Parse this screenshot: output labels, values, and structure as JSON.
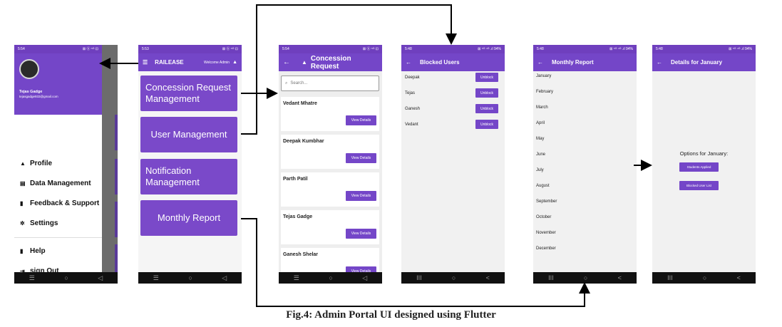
{
  "caption": "Fig.4: Admin Portal UI designed using Flutter",
  "phone1": {
    "status_time": "5:54",
    "status_icons": "⊠ ⓑ ⁵ᴳ ⊡",
    "name": "Tejas Gadge",
    "email": "tejasgadge933@gmail.com",
    "items": [
      {
        "icon": "person-icon",
        "glyph": "▲",
        "label": "Profile"
      },
      {
        "icon": "data-icon",
        "glyph": "▤",
        "label": "Data Management"
      },
      {
        "icon": "feedback-icon",
        "glyph": "▮",
        "label": "Feedback & Support"
      },
      {
        "icon": "gear-icon",
        "glyph": "✲",
        "label": "Settings"
      },
      {
        "icon": "help-icon",
        "glyph": "▮",
        "label": "Help"
      },
      {
        "icon": "logout-icon",
        "glyph": "⇥",
        "label": "sign Out"
      }
    ]
  },
  "phone2": {
    "status_time": "5:53",
    "status_icons": "⊠ ⓑ ⁵ᴳ ⊡",
    "title": "RAILEASE",
    "welcome": "Welcome Admin",
    "cards": [
      "Concession Request Management",
      "User Management",
      "Notification Management",
      "Monthly Report"
    ]
  },
  "phone3": {
    "status_time": "5:54",
    "status_icons": "⊠ ⓑ ⁵ᴳ ⊡",
    "title": "Concession Request",
    "search_placeholder": "Search...",
    "view_label": "View Details",
    "requests": [
      "Vedant Mhatre",
      "Deepak Kumbhar",
      "Parth Patil",
      "Tejas Gadge",
      "Ganesh Shelar"
    ]
  },
  "phone4": {
    "status_time": "5:48",
    "status_icons": "⊠ ⁵ᴳ ⁴ᴳ .ıl 94%",
    "title": "Blocked Users",
    "unblock_label": "Unblock",
    "users": [
      "Deepak",
      "Tejas",
      "Ganesh",
      "Vedant"
    ]
  },
  "phone5": {
    "status_time": "5:48",
    "status_icons": "⊠ ⁵ᴳ ⁴ᴳ .ıl 94%",
    "title": "Monthly Report",
    "months": [
      "January",
      "February",
      "March",
      "April",
      "May",
      "June",
      "July",
      "August",
      "September",
      "October",
      "November",
      "December"
    ]
  },
  "phone6": {
    "status_time": "5:48",
    "status_icons": "⊠ ⁵ᴳ ⁴ᴳ .ıl 94%",
    "title": "Details for January",
    "options_label": "Options for January:",
    "students_applied": "Students Applied",
    "blocked_user_list": "Blocked User List"
  },
  "navbar": {
    "recent": "☰",
    "home": "○",
    "back": "◁"
  },
  "navbar2": {
    "recent": "III",
    "home": "○",
    "back": "<"
  },
  "colors": {
    "primary": "#7446c8",
    "status": "#6f3fbe",
    "nav": "#111111"
  }
}
